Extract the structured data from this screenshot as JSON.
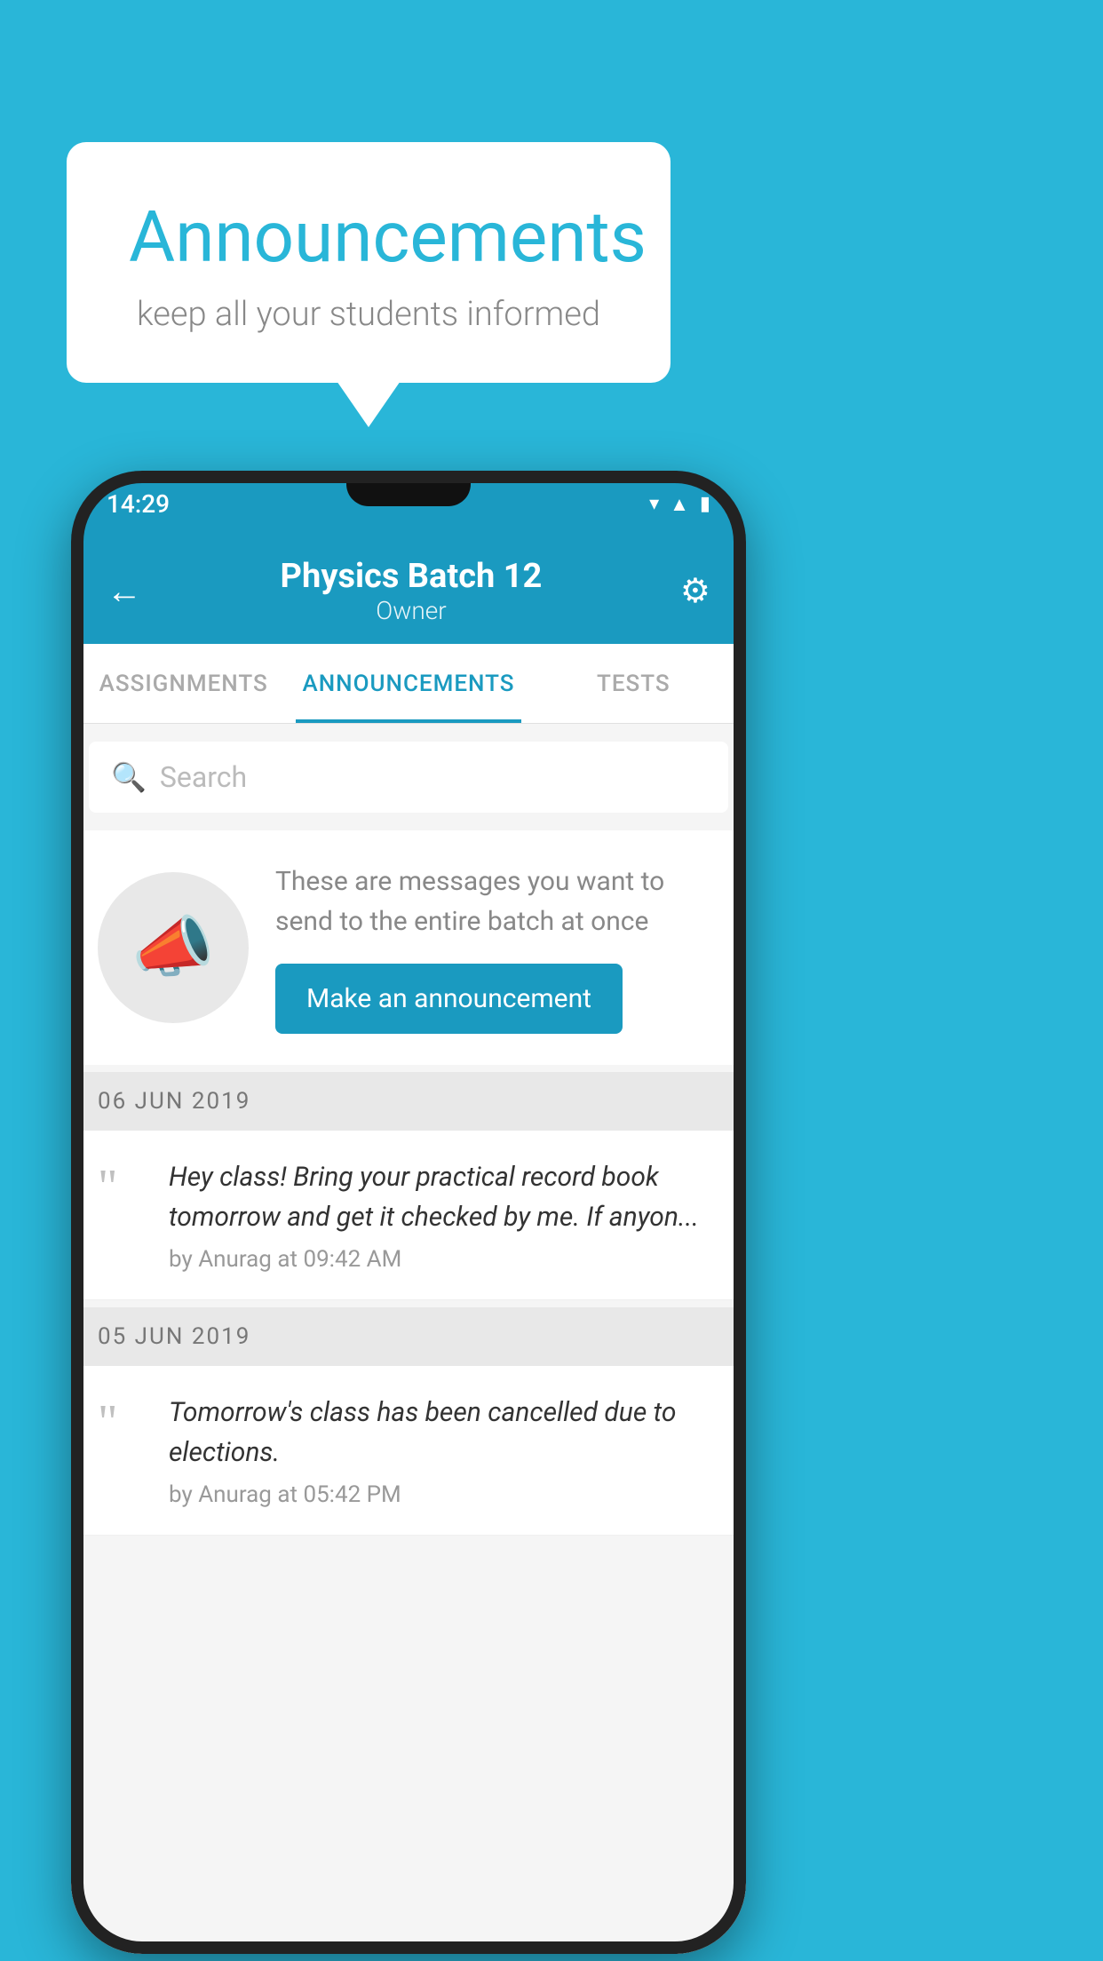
{
  "background": {
    "color": "#29b6d8"
  },
  "speech_bubble": {
    "title": "Announcements",
    "subtitle": "keep all your students informed"
  },
  "phone": {
    "status_bar": {
      "time": "14:29"
    },
    "app_bar": {
      "title": "Physics Batch 12",
      "subtitle": "Owner",
      "back_label": "←",
      "settings_label": "⚙"
    },
    "tabs": [
      {
        "label": "ASSIGNMENTS",
        "active": false
      },
      {
        "label": "ANNOUNCEMENTS",
        "active": true
      },
      {
        "label": "TESTS",
        "active": false
      }
    ],
    "search": {
      "placeholder": "Search"
    },
    "promo": {
      "description": "These are messages you want to send to the entire batch at once",
      "button_label": "Make an announcement"
    },
    "announcements": [
      {
        "date": "06  JUN  2019",
        "text": "Hey class! Bring your practical record book tomorrow and get it checked by me. If anyon...",
        "meta": "by Anurag at 09:42 AM"
      },
      {
        "date": "05  JUN  2019",
        "text": "Tomorrow's class has been cancelled due to elections.",
        "meta": "by Anurag at 05:42 PM"
      }
    ]
  }
}
